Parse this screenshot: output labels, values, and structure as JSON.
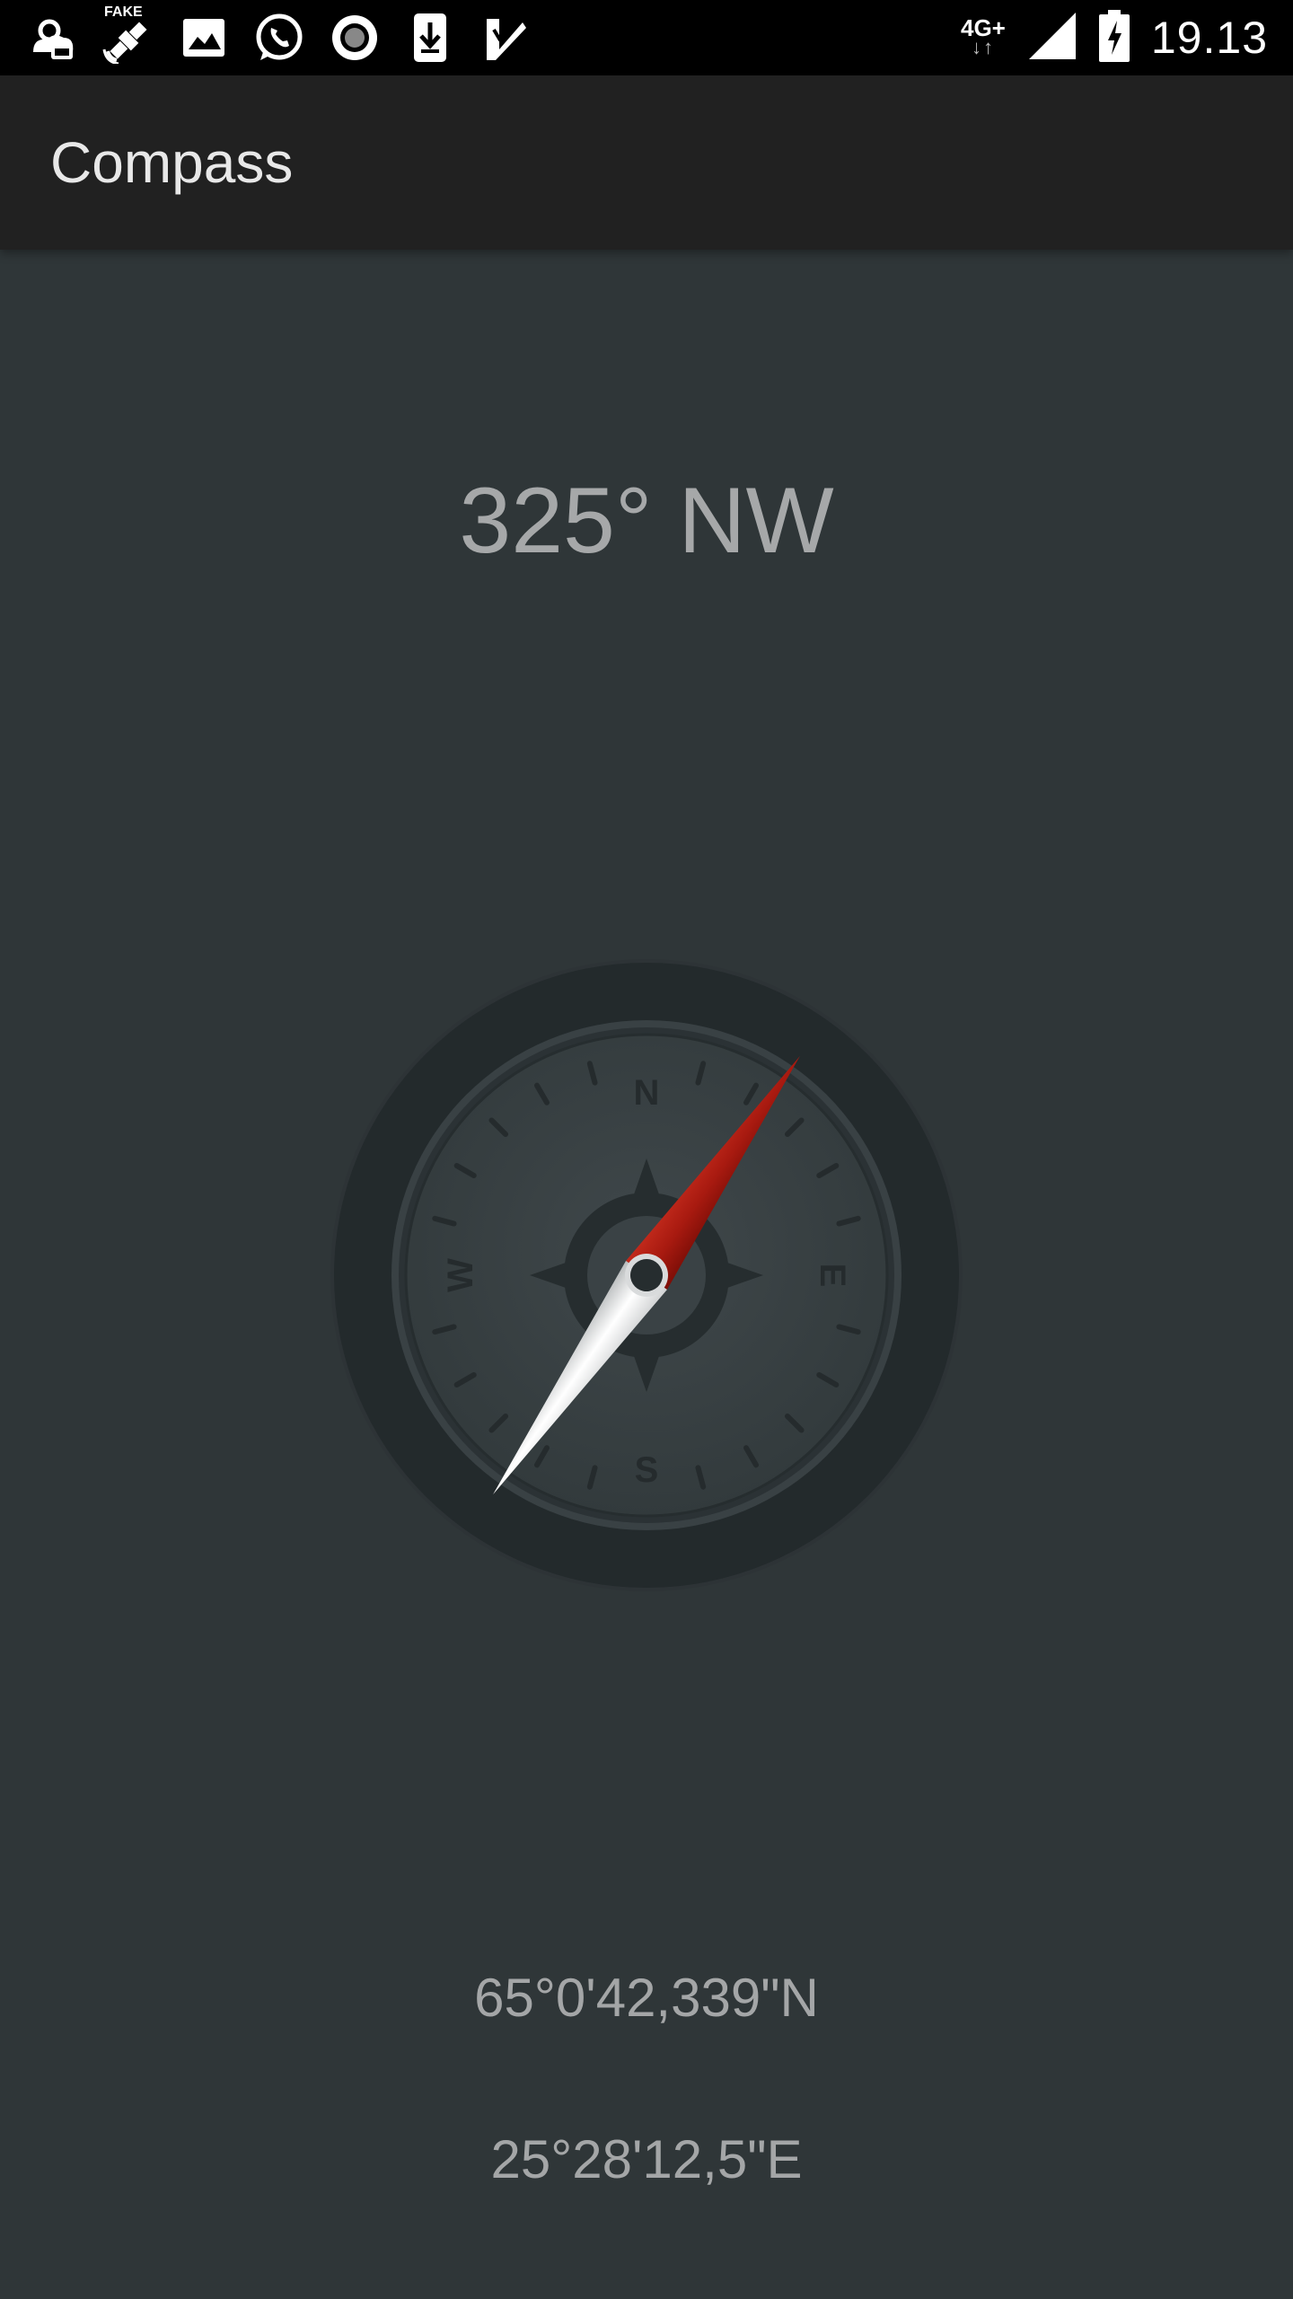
{
  "status_bar": {
    "icons": [
      "weather-cloud-icon",
      "fake-gps-satellite-icon",
      "image-icon",
      "whatsapp-icon",
      "record-icon",
      "download-icon",
      "checkmark-app-icon"
    ],
    "fake_label": "FAKE",
    "network_type": "4G+",
    "signal_icon": "cell-signal-icon",
    "battery_icon": "battery-charging-icon",
    "time": "19.13"
  },
  "app_bar": {
    "title": "Compass"
  },
  "compass": {
    "heading_text": "325° NW",
    "heading_degrees": 325,
    "cardinals": {
      "north": "N",
      "east": "E",
      "south": "S",
      "west": "W"
    },
    "needle_north_color": "#a81a10",
    "needle_south_color": "#e8e8e8"
  },
  "location": {
    "latitude": "65°0'42,339\"N",
    "longitude": "25°28'12,5\"E"
  },
  "colors": {
    "background": "#2f3638",
    "app_bar": "#212121",
    "status_bar": "#000000",
    "text": "#a6a8a9"
  }
}
